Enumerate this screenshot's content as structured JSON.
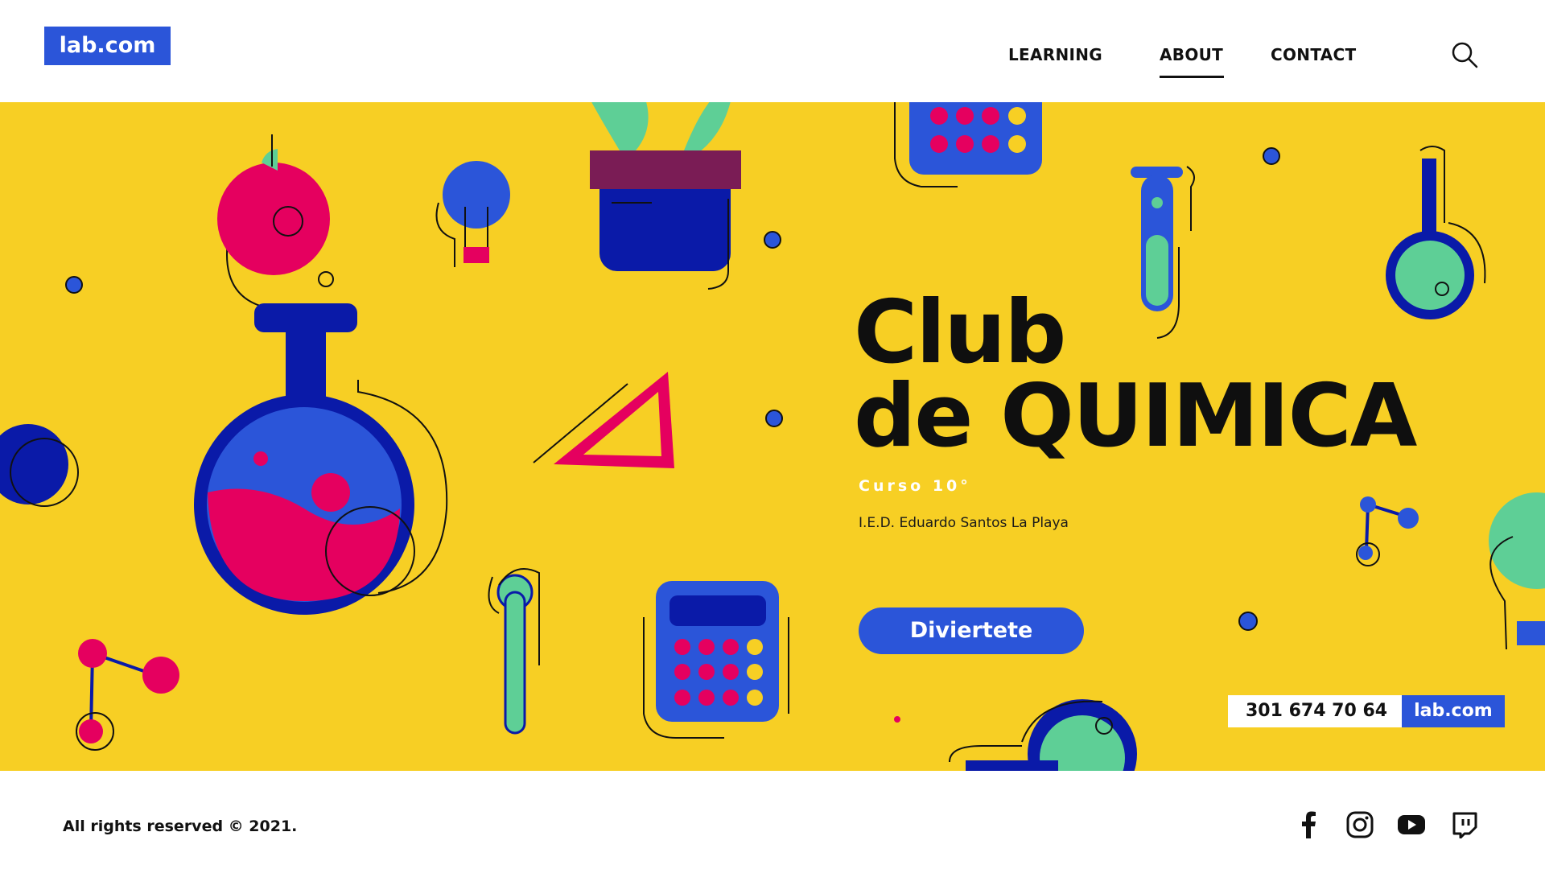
{
  "header": {
    "logo": "lab.com",
    "nav": [
      {
        "label": "LEARNING"
      },
      {
        "label": "ABOUT",
        "active": true
      },
      {
        "label": "CONTACT"
      }
    ],
    "search_icon": "search-icon"
  },
  "hero": {
    "title_line1": "Club",
    "title_line2": "de QUIMICA",
    "subtitle": "Curso 10°",
    "school": "I.E.D. Eduardo Santos La Playa",
    "cta_label": "Diviertete",
    "phone": "301 674 70 64",
    "site": "lab.com"
  },
  "footer": {
    "copyright": "All rights reserved © 2021.",
    "social": [
      "facebook-icon",
      "instagram-icon",
      "youtube-icon",
      "twitch-icon"
    ]
  },
  "colors": {
    "yellow": "#f7cf24",
    "blue": "#2b55d9",
    "navy": "#0a1aa8",
    "pink": "#e5005f",
    "green": "#5ecf96",
    "maroon": "#7a1c55"
  }
}
